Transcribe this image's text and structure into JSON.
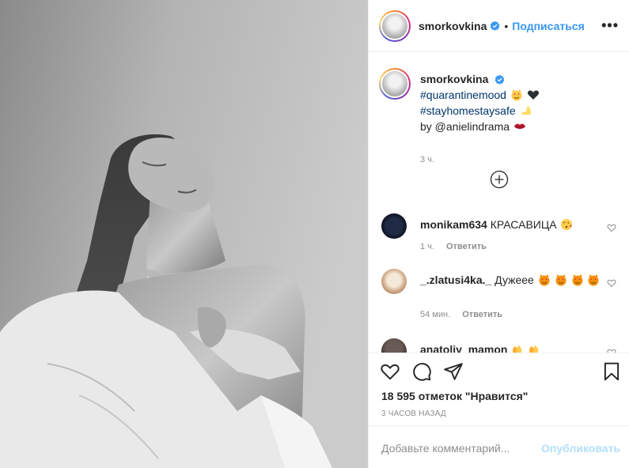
{
  "post": {
    "photo_alt": "",
    "username": "smorkovkina",
    "follow_label": "Подписаться",
    "more_label": "•••",
    "dot": "•"
  },
  "caption": {
    "username": "smorkovkina",
    "lines": [
      "#quarantinemood",
      "#stayhomestaysafe",
      "by @anielindrama"
    ],
    "time": "3 ч."
  },
  "comments": [
    {
      "username": "monikam634",
      "text": "КРАСАВИЦА",
      "emojis": [
        "kissing-heart"
      ],
      "time": "1 ч.",
      "reply": "Ответить"
    },
    {
      "username": "_.zlatusi4ka._",
      "text": "Дужеее",
      "emojis": [
        "heart-eyes-cat",
        "heart-eyes-cat",
        "heart-eyes-cat",
        "heart-eyes-cat"
      ],
      "time": "54 мин.",
      "reply": "Ответить"
    },
    {
      "username": "anatoliy_mamon",
      "text": "",
      "emojis": [
        "clap",
        "clap"
      ],
      "time": "",
      "reply": ""
    }
  ],
  "likes": {
    "count_text": "18 595 отметок \"Нравится\"",
    "ago": "3 часов назад"
  },
  "add_comment": {
    "placeholder": "Добавьте комментарий...",
    "publish_label": "Опубликовать"
  },
  "colors": {
    "link": "#003569",
    "follow": "#3897f0",
    "muted": "#8e8e8e",
    "publish_disabled": "#b2dffc"
  },
  "icons": [
    "verified-badge-icon",
    "more-options-icon",
    "load-more-comments-icon",
    "heart-icon",
    "comment-icon",
    "share-icon",
    "bookmark-icon"
  ]
}
